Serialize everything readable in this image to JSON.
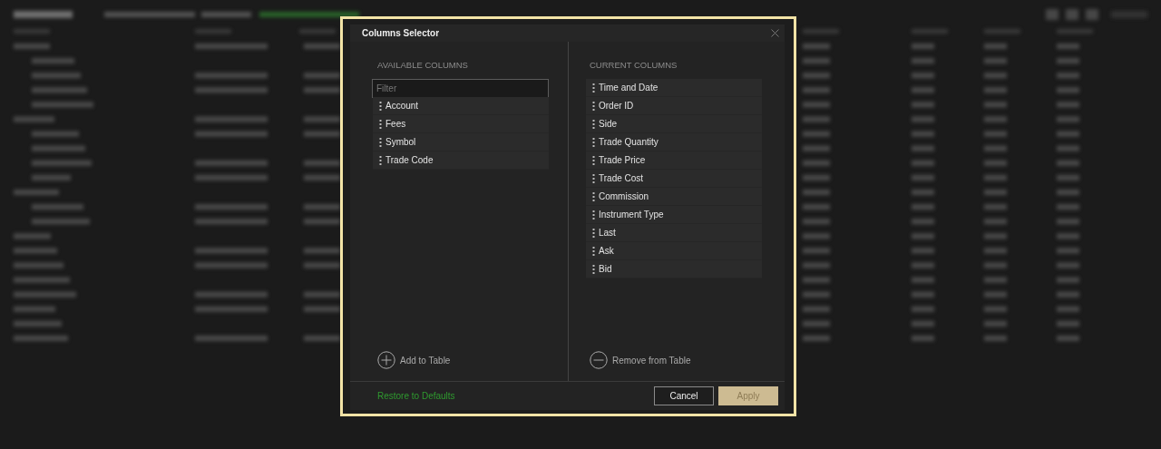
{
  "dialog": {
    "title": "Columns Selector",
    "available": {
      "heading": "AVAILABLE COLUMNS",
      "filter": {
        "placeholder": "Filter"
      },
      "items": [
        "Account",
        "Fees",
        "Symbol",
        "Trade Code"
      ],
      "action": "Add to Table"
    },
    "current": {
      "heading": "CURRENT COLUMNS",
      "items": [
        "Time and Date",
        "Order ID",
        "Side",
        "Trade Quantity",
        "Trade Price",
        "Trade Cost",
        "Commission",
        "Instrument Type",
        "Last",
        "Ask",
        "Bid"
      ],
      "action": "Remove from Table"
    },
    "restore_link": "Restore to Defaults",
    "buttons": [
      {
        "label": "Cancel",
        "kind": "secondary"
      },
      {
        "label": "Apply",
        "kind": "primary"
      }
    ]
  }
}
